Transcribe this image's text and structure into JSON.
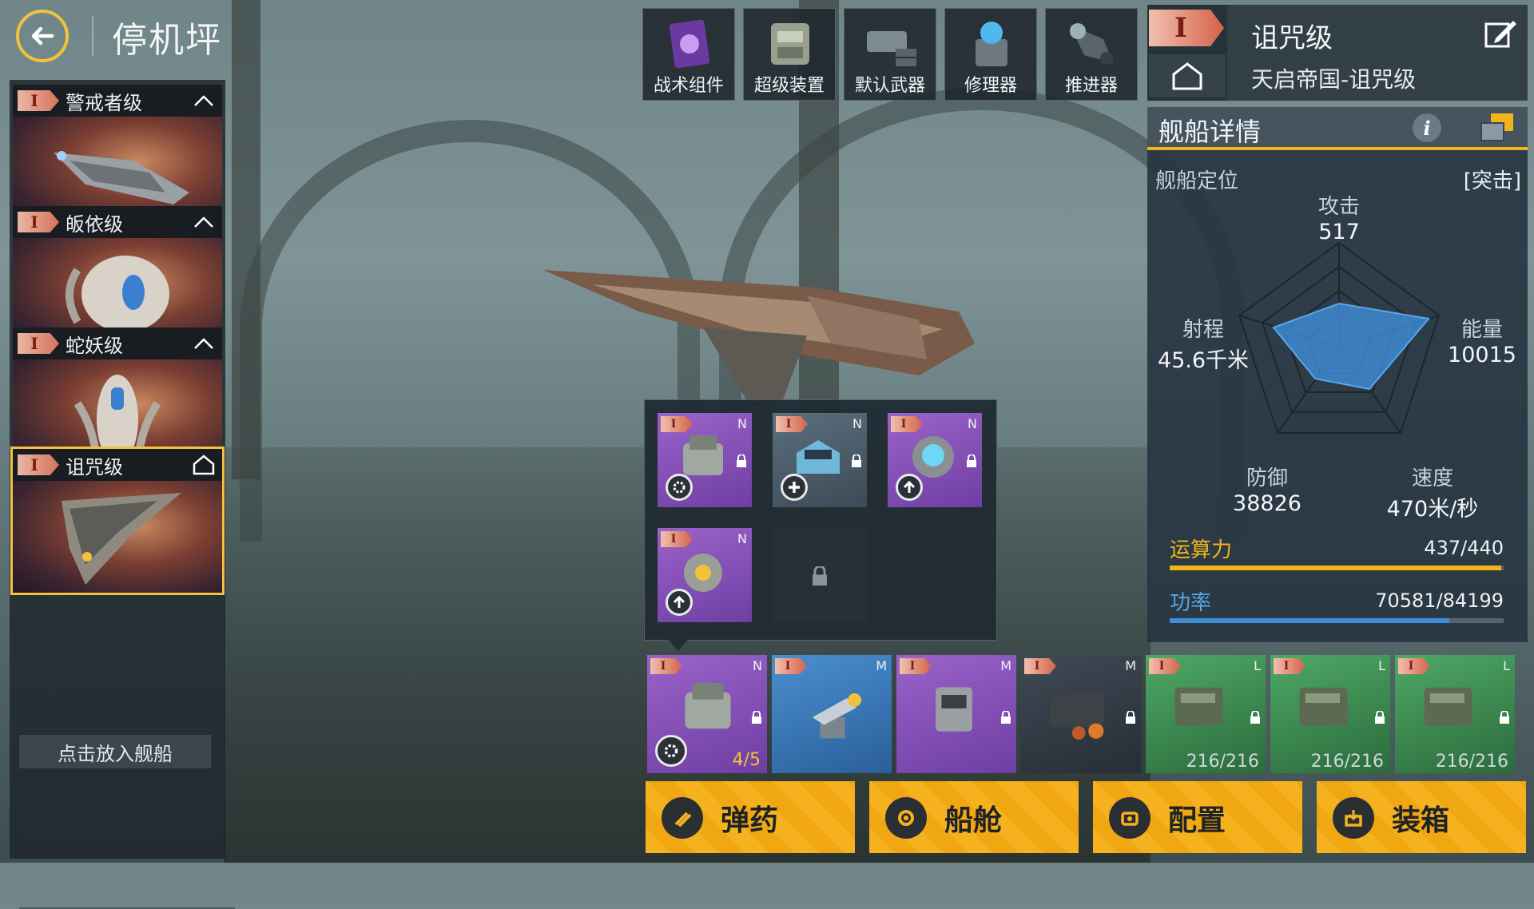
{
  "header": {
    "title": "停机坪"
  },
  "ship_list": {
    "ships": [
      {
        "tier": "I",
        "name": "警戒者级"
      },
      {
        "tier": "I",
        "name": "皈依级"
      },
      {
        "tier": "I",
        "name": "蛇妖级"
      },
      {
        "tier": "I",
        "name": "诅咒级"
      }
    ],
    "selected_index": 3,
    "put_ship_label": "点击放入舰船"
  },
  "equip_tabs": [
    {
      "label": "战术组件",
      "icon": "tactical-component-icon"
    },
    {
      "label": "超级装置",
      "icon": "super-device-icon"
    },
    {
      "label": "默认武器",
      "icon": "default-weapon-icon"
    },
    {
      "label": "修理器",
      "icon": "repairer-icon"
    },
    {
      "label": "推进器",
      "icon": "thruster-icon"
    }
  ],
  "ship_title": {
    "tier": "I",
    "class": "诅咒级",
    "full_name": "天启帝国-诅咒级"
  },
  "details": {
    "title": "舰船详情",
    "info": "i",
    "role_label": "舰船定位",
    "role_value": "[突击]",
    "stats": {
      "attack": {
        "label": "攻击",
        "value": "517"
      },
      "energy": {
        "label": "能量",
        "value": "10015"
      },
      "speed": {
        "label": "速度",
        "value": "470米/秒"
      },
      "defense": {
        "label": "防御",
        "value": "38826"
      },
      "range": {
        "label": "射程",
        "value": "45.6千米"
      }
    },
    "compute": {
      "label": "运算力",
      "value": "437/440",
      "fraction": 0.993,
      "color": "#f3b31a"
    },
    "power": {
      "label": "功率",
      "value": "70581/84199",
      "fraction": 0.838,
      "color": "#3f8fd8"
    }
  },
  "module_popup": {
    "slots": [
      {
        "tier": "I",
        "size": "N",
        "color": "purple",
        "action": "gear"
      },
      {
        "tier": "I",
        "size": "N",
        "color": "gray",
        "action": "plus"
      },
      {
        "tier": "I",
        "size": "N",
        "color": "purple",
        "action": "up"
      },
      {
        "tier": "I",
        "size": "N",
        "color": "purple",
        "action": "up"
      }
    ]
  },
  "equipment_row": [
    {
      "tier": "I",
      "size": "N",
      "color": "purple",
      "extra": "4/5"
    },
    {
      "tier": "I",
      "size": "M",
      "color": "blue",
      "extra": ""
    },
    {
      "tier": "I",
      "size": "M",
      "color": "purple",
      "extra": ""
    },
    {
      "tier": "I",
      "size": "M",
      "color": "dark",
      "extra": ""
    },
    {
      "tier": "I",
      "size": "L",
      "color": "green",
      "extra": "216/216"
    },
    {
      "tier": "I",
      "size": "L",
      "color": "green",
      "extra": "216/216"
    },
    {
      "tier": "I",
      "size": "L",
      "color": "green",
      "extra": "216/216"
    }
  ],
  "actions": [
    {
      "label": "弹药",
      "icon": "ammo-icon"
    },
    {
      "label": "船舱",
      "icon": "cabin-icon"
    },
    {
      "label": "配置",
      "icon": "config-icon"
    },
    {
      "label": "装箱",
      "icon": "packing-icon"
    }
  ],
  "colors": {
    "accent": "#f3c23a",
    "tier_badge": "#d4634a",
    "purple_slot": "#8a52bf",
    "green_slot": "#3f8f55"
  }
}
